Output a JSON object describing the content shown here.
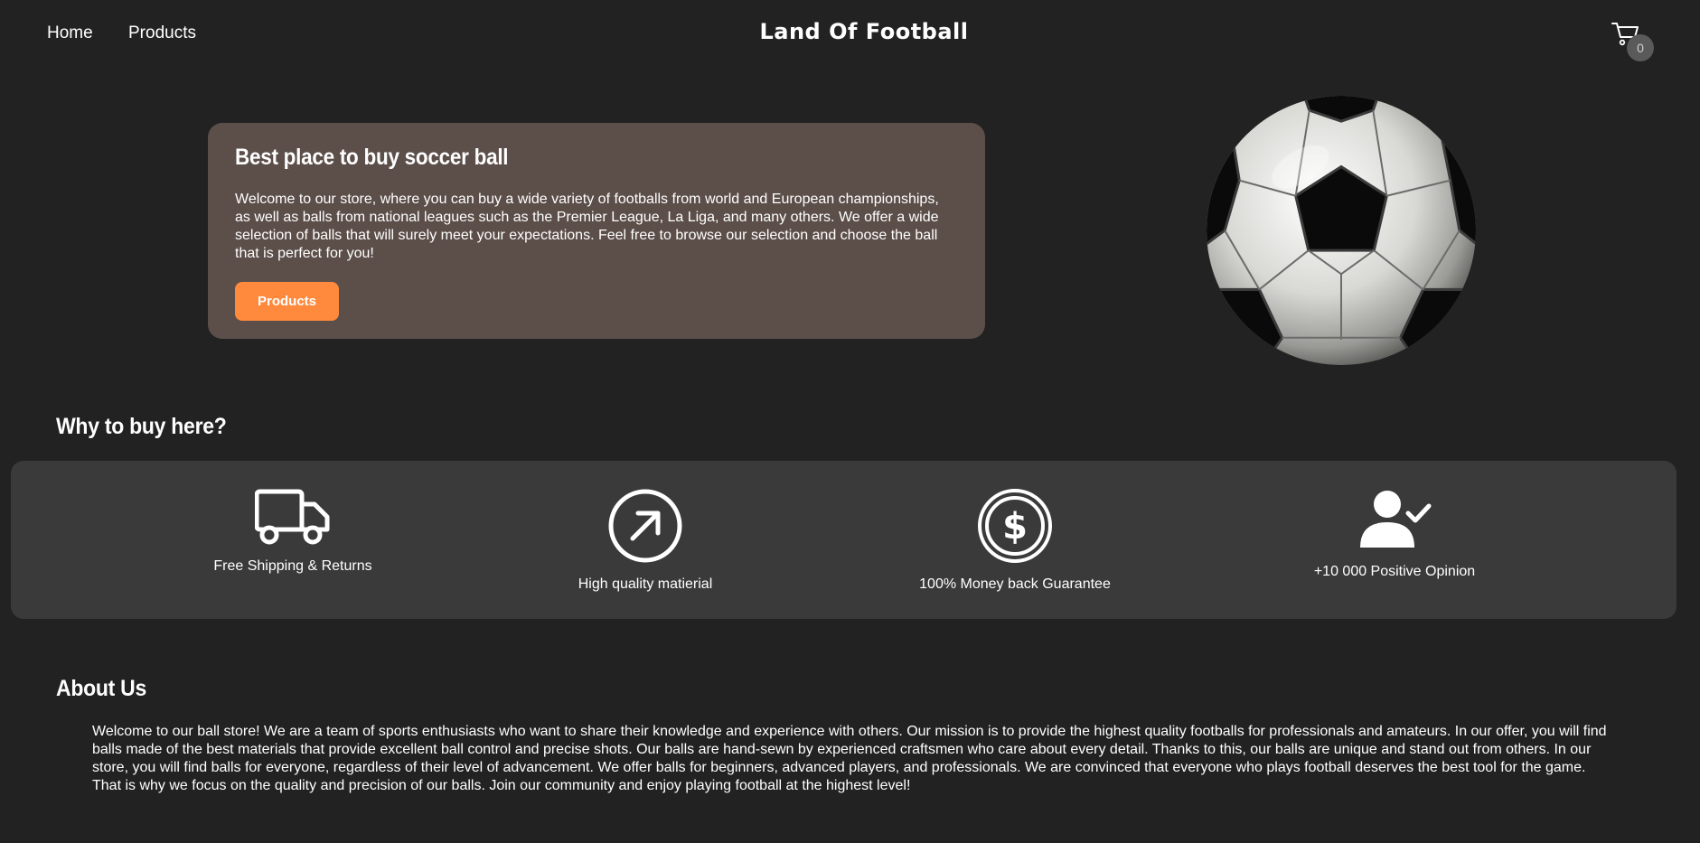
{
  "header": {
    "nav": [
      {
        "label": "Home"
      },
      {
        "label": "Products"
      }
    ],
    "brand": "Land Of Football",
    "cart": {
      "icon": "cart-icon",
      "count": "0"
    }
  },
  "hero": {
    "title": "Best place to buy soccer ball",
    "text": "Welcome to our store, where you can buy a wide variety of footballs from world and European championships, as well as balls from national leagues such as the Premier League, La Liga, and many others. We offer a wide selection of balls that will surely meet your expectations. Feel free to browse our selection and choose the ball that is perfect for you!",
    "button_label": "Products",
    "image": "soccer-ball-image"
  },
  "why": {
    "heading": "Why to buy here?",
    "features": [
      {
        "icon": "truck-icon",
        "label": "Free Shipping & Returns"
      },
      {
        "icon": "arrow-up-right-circle-icon",
        "label": "High quality matierial"
      },
      {
        "icon": "dollar-circle-icon",
        "label": "100% Money back Guarantee"
      },
      {
        "icon": "user-check-icon",
        "label": "+10 000 Positive Opinion"
      }
    ]
  },
  "about": {
    "heading": "About Us",
    "text": "Welcome to our ball store! We are a team of sports enthusiasts who want to share their knowledge and experience with others. Our mission is to provide the highest quality footballs for professionals and amateurs. In our offer, you will find balls made of the best materials that provide excellent ball control and precise shots. Our balls are hand-sewn by experienced craftsmen who care about every detail. Thanks to this, our balls are unique and stand out from others. In our store, you will find balls for everyone, regardless of their level of advancement. We offer balls for beginners, advanced players, and professionals. We are convinced that everyone who plays football deserves the best tool for the game. That is why we focus on the quality and precision of our balls. Join our community and enjoy playing football at the highest level!"
  },
  "colors": {
    "background": "#222222",
    "hero_card": "#5c4f4a",
    "accent": "#ff8a3d",
    "features_panel": "#3a3a3a"
  }
}
